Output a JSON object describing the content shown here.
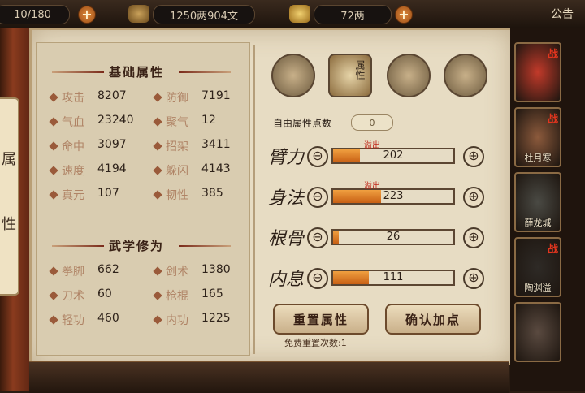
{
  "topbar": {
    "energy": "10/180",
    "money": "1250两904文",
    "gold": "72两",
    "notice_label": "公告",
    "plus_label": "+"
  },
  "scroll": {
    "char_top": "属",
    "char_bottom": "性"
  },
  "basic": {
    "title": "基础属性",
    "stats": [
      {
        "label": "攻击",
        "value": "8207"
      },
      {
        "label": "防御",
        "value": "7191"
      },
      {
        "label": "气血",
        "value": "23240"
      },
      {
        "label": "聚气",
        "value": "12"
      },
      {
        "label": "命中",
        "value": "3097"
      },
      {
        "label": "招架",
        "value": "3411"
      },
      {
        "label": "速度",
        "value": "4194"
      },
      {
        "label": "躲闪",
        "value": "4143"
      },
      {
        "label": "真元",
        "value": "107"
      },
      {
        "label": "韧性",
        "value": "385"
      }
    ]
  },
  "martial": {
    "title": "武学修为",
    "stats": [
      {
        "label": "拳脚",
        "value": "662"
      },
      {
        "label": "剑术",
        "value": "1380"
      },
      {
        "label": "刀术",
        "value": "60"
      },
      {
        "label": "枪棍",
        "value": "165"
      },
      {
        "label": "轻功",
        "value": "460"
      },
      {
        "label": "内功",
        "value": "1225"
      }
    ]
  },
  "tabs": {
    "attr_tab_label": "属性",
    "icons": [
      "hero-portrait-icon",
      "attribute-book-icon",
      "yin-yang-icon",
      "meridian-body-icon"
    ]
  },
  "free_points": {
    "label": "自由属性点数",
    "value": "0"
  },
  "attributes": [
    {
      "name": "臂力",
      "value": "202",
      "fill": 0.22,
      "overflow": "溢出"
    },
    {
      "name": "身法",
      "value": "223",
      "fill": 0.4,
      "overflow": "溢出"
    },
    {
      "name": "根骨",
      "value": "26",
      "fill": 0.05,
      "overflow": ""
    },
    {
      "name": "内息",
      "value": "111",
      "fill": 0.3,
      "overflow": ""
    }
  ],
  "buttons": {
    "minus": "⊖",
    "plus": "⊕",
    "reset": "重置属性",
    "confirm": "确认加点",
    "reset_count": "免费重置次数:1"
  },
  "heroes": [
    {
      "name": "",
      "badge": "战"
    },
    {
      "name": "杜月寒",
      "badge": "战"
    },
    {
      "name": "薛龙城",
      "badge": ""
    },
    {
      "name": "陶渊溢",
      "badge": "战"
    },
    {
      "name": "",
      "badge": ""
    }
  ],
  "colors": {
    "accent_red": "#e2351e",
    "bar_orange": "#e8882c",
    "parchment": "#e7dcc3"
  }
}
